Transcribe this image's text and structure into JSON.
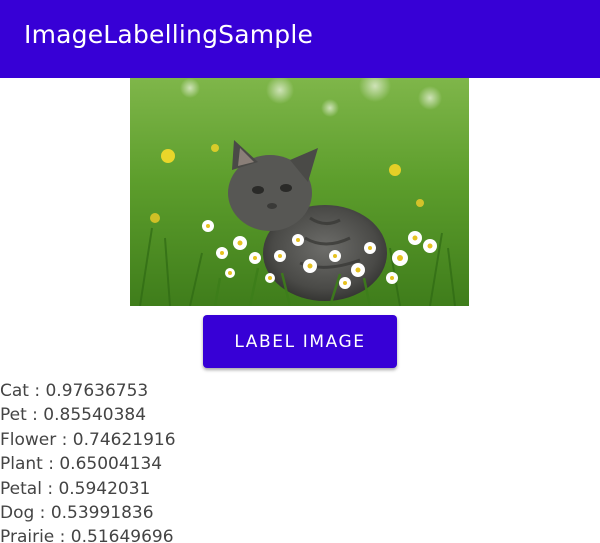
{
  "app_bar": {
    "title": "ImageLabellingSample",
    "color": "#3700d6"
  },
  "image": {
    "subject_icon": "kitten-in-daisies-photo"
  },
  "button": {
    "label": "LABEL IMAGE",
    "color": "#3700d6"
  },
  "results": [
    {
      "text": "Cat : 0.97636753"
    },
    {
      "text": "Pet : 0.85540384"
    },
    {
      "text": "Flower : 0.74621916"
    },
    {
      "text": "Plant : 0.65004134"
    },
    {
      "text": "Petal : 0.5942031"
    },
    {
      "text": "Dog : 0.53991836"
    },
    {
      "text": "Prairie : 0.51649696"
    }
  ]
}
